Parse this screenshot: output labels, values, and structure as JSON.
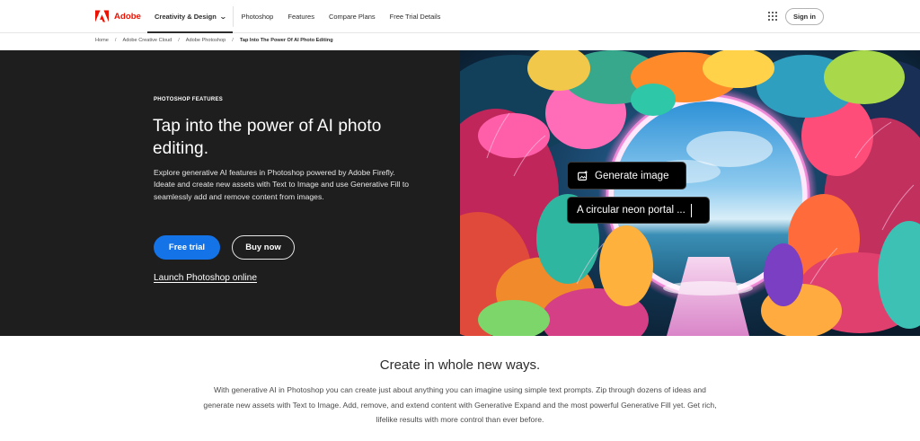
{
  "brand": {
    "name": "Adobe",
    "accent": "#eb1000"
  },
  "nav": {
    "items": [
      {
        "label": "Creativity & Design",
        "active": true
      },
      {
        "label": "Photoshop"
      },
      {
        "label": "Features"
      },
      {
        "label": "Compare Plans"
      },
      {
        "label": "Free Trial Details"
      }
    ],
    "apps_icon": "apps-grid-icon",
    "sign_in": "Sign in"
  },
  "breadcrumb": [
    "Home",
    "Adobe Creative Cloud",
    "Adobe Photoshop",
    "Tap Into The Power Of AI Photo Editing"
  ],
  "hero": {
    "eyebrow": "PHOTOSHOP FEATURES",
    "title": "Tap into the power of AI photo editing.",
    "description": "Explore generative AI features in Photoshop powered by Adobe Firefly. Ideate and create new assets with Text to Image and use Generative Fill to seamlessly add and remove content from images.",
    "primary_button": "Free trial",
    "secondary_button": "Buy now",
    "link": "Launch Photoshop online",
    "primary_color": "#1473e6",
    "background": "#1e1e1e",
    "overlay": {
      "generate_label": "Generate image",
      "generate_icon": "sparkle-image-icon",
      "prompt_text": "A circular neon portal ..."
    }
  },
  "section": {
    "title": "Create in whole new ways.",
    "body": "With generative AI in Photoshop you can create just about anything you can imagine using simple text prompts. Zip through dozens of ideas and generate new assets with Text to Image. Add, remove, and extend content with Generative Expand and the most powerful Generative Fill yet. Get rich, lifelike results with more control than ever before."
  }
}
